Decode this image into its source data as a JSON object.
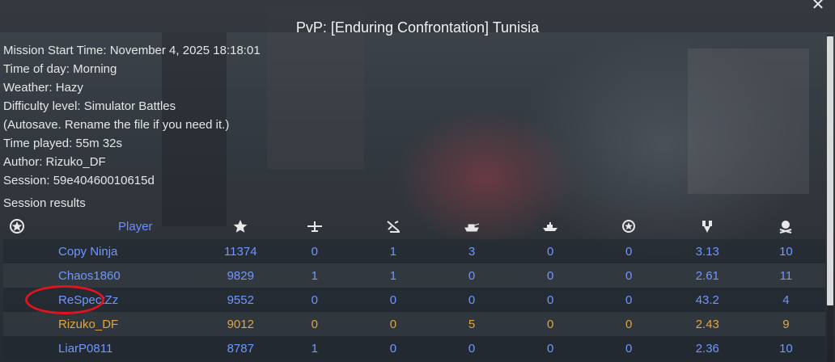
{
  "header": {
    "title": "PvP: [Enduring Confrontation] Tunisia",
    "close_icon": "close-icon"
  },
  "info": [
    "Mission Start Time: November 4, 2025 18:18:01",
    "Time of day: Morning",
    "Weather: Hazy",
    "Difficulty level: Simulator Battles",
    "(Autosave. Rename the file if you need it.)",
    "Time played: 55m 32s",
    "Author: Rizuko_DF",
    "Session: 59e40460010615d"
  ],
  "results": {
    "label": "Session results",
    "columns": [
      "squad-icon",
      "Player",
      "score-icon",
      "air-kills-icon",
      "ground-aircraft-kills-icon",
      "tank-kills-icon",
      "ship-kills-icon",
      "assists-icon",
      "lifetime-icon",
      "deaths-icon"
    ],
    "player_header": "Player",
    "rows": [
      {
        "name": "Copy Ninja",
        "score": "11374",
        "air": "0",
        "gair": "1",
        "tank": "3",
        "ship": "0",
        "assist": "0",
        "time": "3.13",
        "deaths": "10",
        "team": "blue"
      },
      {
        "name": "Chaos1860",
        "score": "9829",
        "air": "1",
        "gair": "1",
        "tank": "0",
        "ship": "0",
        "assist": "0",
        "time": "2.61",
        "deaths": "11",
        "team": "blue"
      },
      {
        "name": "ReSpectZz",
        "score": "9552",
        "air": "0",
        "gair": "0",
        "tank": "0",
        "ship": "0",
        "assist": "0",
        "time": "43.2",
        "deaths": "4",
        "team": "blue"
      },
      {
        "name": "Rizuko_DF",
        "score": "9012",
        "air": "0",
        "gair": "0",
        "tank": "5",
        "ship": "0",
        "assist": "0",
        "time": "2.43",
        "deaths": "9",
        "team": "gold"
      },
      {
        "name": "LiarP0811",
        "score": "8787",
        "air": "1",
        "gair": "0",
        "tank": "0",
        "ship": "0",
        "assist": "0",
        "time": "2.36",
        "deaths": "10",
        "team": "blue"
      }
    ]
  },
  "colors": {
    "blue_team": "#7097ff",
    "own_player": "#e0a53e",
    "highlight_circle": "#e0141e"
  }
}
